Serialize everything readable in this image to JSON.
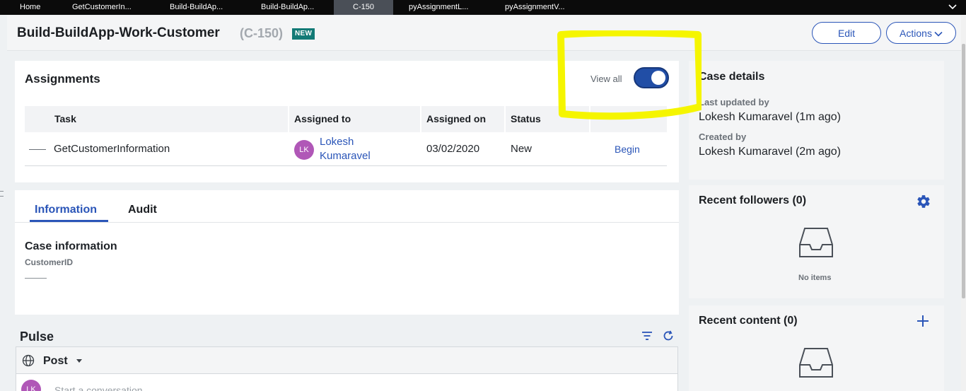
{
  "tabs": [
    {
      "label": "Home"
    },
    {
      "label": "GetCustomerIn..."
    },
    {
      "label": "Build-BuildAp..."
    },
    {
      "label": "Build-BuildAp..."
    },
    {
      "label": "C-150"
    },
    {
      "label": "pyAssignmentL..."
    },
    {
      "label": "pyAssignmentV..."
    }
  ],
  "header": {
    "title": "Build-BuildApp-Work-Customer",
    "case_id": "(C-150)",
    "badge": "NEW",
    "edit_label": "Edit",
    "actions_label": "Actions"
  },
  "assignments": {
    "title": "Assignments",
    "view_all_label": "View all",
    "view_all_on": true,
    "columns": [
      "Task",
      "Assigned to",
      "Assigned on",
      "Status"
    ],
    "rows": [
      {
        "task": "GetCustomerInformation",
        "avatar_initials": "LK",
        "assignee_first": "Lokesh",
        "assignee_last": "Kumaravel",
        "assigned_on": "03/02/2020",
        "status": "New",
        "action": "Begin"
      }
    ]
  },
  "info": {
    "tabs": [
      "Information",
      "Audit"
    ],
    "section_title": "Case information",
    "field_label": "CustomerID"
  },
  "pulse": {
    "title": "Pulse",
    "post_label": "Post",
    "avatar_initials": "LK",
    "placeholder": "Start a conversation"
  },
  "case_details": {
    "title": "Case details",
    "last_updated_label": "Last updated by",
    "last_updated_value": "Lokesh Kumaravel (1m ago)",
    "created_label": "Created by",
    "created_value": "Lokesh Kumaravel (2m ago)"
  },
  "followers": {
    "title": "Recent followers (0)",
    "empty_text": "No items"
  },
  "recent_content": {
    "title": "Recent content (0)"
  },
  "colors": {
    "accent": "#2a55b8",
    "badge": "#127a76",
    "avatar": "#b057b7",
    "highlight": "#f5f500"
  }
}
